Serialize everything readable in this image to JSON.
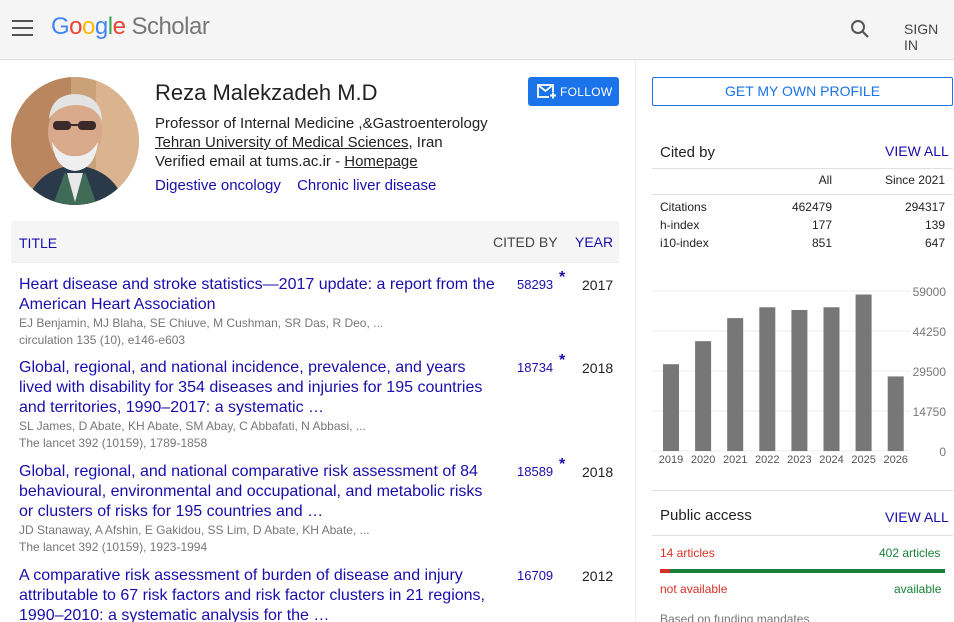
{
  "header": {
    "logo_google": [
      "G",
      "o",
      "o",
      "g",
      "l",
      "e"
    ],
    "logo_scholar": "Scholar",
    "sign_in": "SIGN IN"
  },
  "profile": {
    "name": "Reza Malekzadeh M.D",
    "follow_label": "FOLLOW",
    "position": "Professor of Internal Medicine ,&Gastroenterology",
    "institution": "Tehran University of Medical Sciences",
    "country": ", Iran",
    "verified_email": "Verified email at tums.ac.ir - ",
    "homepage": "Homepage",
    "interests": [
      "Digestive oncology",
      "Chronic liver disease"
    ]
  },
  "table": {
    "title_header": "TITLE",
    "cited_header": "CITED BY",
    "year_header": "YEAR",
    "articles": [
      {
        "title": "Heart disease and stroke statistics—2017 update: a report from the American Heart Association",
        "authors": "EJ Benjamin, MJ Blaha, SE Chiuve, M Cushman, SR Das, R Deo, ...",
        "venue": "circulation 135 (10), e146-e603",
        "cited": "58293",
        "star": "*",
        "year": "2017"
      },
      {
        "title": "Global, regional, and national incidence, prevalence, and years lived with disability for 354 diseases and injuries for 195 countries and territories, 1990–2017: a systematic …",
        "authors": "SL James, D Abate, KH Abate, SM Abay, C Abbafati, N Abbasi, ...",
        "venue": "The lancet 392 (10159), 1789-1858",
        "cited": "18734",
        "star": "*",
        "year": "2018"
      },
      {
        "title": "Global, regional, and national comparative risk assessment of 84 behavioural, environmental and occupational, and metabolic risks or clusters of risks for 195 countries and …",
        "authors": "JD Stanaway, A Afshin, E Gakidou, SS Lim, D Abate, KH Abate, ...",
        "venue": "The lancet 392 (10159), 1923-1994",
        "cited": "18589",
        "star": "*",
        "year": "2018"
      },
      {
        "title": "A comparative risk assessment of burden of disease and injury attributable to 67 risk factors and risk factor clusters in 21 regions, 1990–2010: a systematic analysis for the …",
        "authors": "",
        "venue": "",
        "cited": "16709",
        "star": "",
        "year": "2012"
      }
    ]
  },
  "sidebar": {
    "own_profile": "GET MY OWN PROFILE",
    "cited_by": "Cited by",
    "view_all": "VIEW ALL",
    "stats_headers": [
      "",
      "All",
      "Since 2021"
    ],
    "stats": [
      [
        "Citations",
        "462479",
        "294317"
      ],
      [
        "h-index",
        "177",
        "139"
      ],
      [
        "i10-index",
        "851",
        "647"
      ]
    ],
    "public_access": "Public access",
    "pa_view_all": "VIEW ALL",
    "not_available_count": "14 articles",
    "available_count": "402 articles",
    "not_available_fraction": 0.034,
    "not_available": "not available",
    "available": "available",
    "mandates": "Based on funding mandates"
  },
  "chart_data": {
    "type": "bar",
    "categories": [
      "2019",
      "2020",
      "2021",
      "2022",
      "2023",
      "2024",
      "2025",
      "2026"
    ],
    "values": [
      32000,
      40500,
      49000,
      53000,
      52000,
      53000,
      57700,
      27500
    ],
    "yticks": [
      "59000",
      "44250",
      "29500",
      "14750",
      "0"
    ],
    "ylim": [
      0,
      59000
    ],
    "bar_color": "#777777"
  },
  "colors": {
    "link": "#1a0dab",
    "accent": "#1a73e8",
    "red": "#d93025",
    "green": "#188038"
  }
}
